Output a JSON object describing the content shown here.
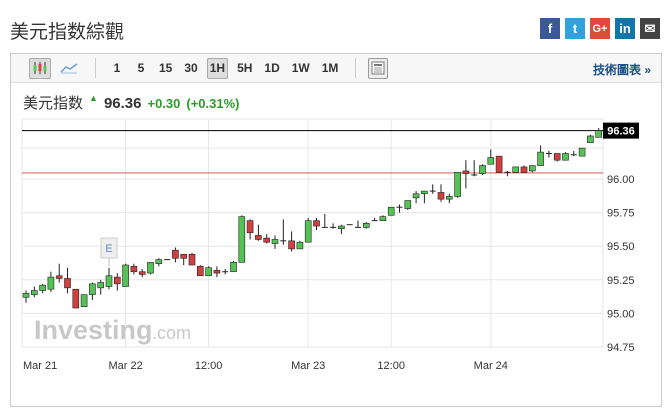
{
  "header": {
    "title": "美元指数綜觀"
  },
  "social": [
    {
      "name": "facebook",
      "glyph": "f",
      "color": "#3b5998"
    },
    {
      "name": "twitter",
      "glyph": "t",
      "color": "#2fa3e0"
    },
    {
      "name": "google-plus",
      "glyph": "G+",
      "color": "#dd4b39"
    },
    {
      "name": "linkedin",
      "glyph": "in",
      "color": "#0e76a8"
    },
    {
      "name": "email",
      "glyph": "✉",
      "color": "#444"
    }
  ],
  "toolbar": {
    "intervals": [
      "1",
      "5",
      "15",
      "30",
      "1H",
      "5H",
      "1D",
      "1W",
      "1M"
    ],
    "active": "1H",
    "tech_link": "技術圖表 »"
  },
  "quote": {
    "name": "美元指数",
    "price": "96.36",
    "change": "+0.30",
    "change_pct": "(+0.31%)"
  },
  "chart_data": {
    "type": "candlestick",
    "ylim": [
      94.75,
      96.45
    ],
    "yticks": [
      "96.00",
      "95.75",
      "95.50",
      "95.25",
      "95.00",
      "94.75"
    ],
    "last_price_label": "96.36",
    "last_price": 96.36,
    "reference_line": 96.045,
    "xlabels": [
      {
        "text": "Mar 21",
        "index": 1.7
      },
      {
        "text": "Mar 22",
        "index": 12
      },
      {
        "text": "12:00",
        "index": 22
      },
      {
        "text": "Mar 23",
        "index": 34
      },
      {
        "text": "12:00",
        "index": 44
      },
      {
        "text": "Mar 24",
        "index": 56
      }
    ],
    "event_marker": {
      "label": "E",
      "index": 10
    },
    "watermark": "Investing.com",
    "colors": {
      "up": "#55c255",
      "down": "#d04040"
    },
    "ohlc": [
      [
        95.12,
        95.17,
        95.08,
        95.15
      ],
      [
        95.14,
        95.2,
        95.12,
        95.17
      ],
      [
        95.17,
        95.22,
        95.15,
        95.21
      ],
      [
        95.18,
        95.31,
        95.16,
        95.27
      ],
      [
        95.28,
        95.37,
        95.23,
        95.26
      ],
      [
        95.26,
        95.34,
        95.15,
        95.19
      ],
      [
        95.18,
        95.18,
        95.04,
        95.04
      ],
      [
        95.05,
        95.14,
        95.05,
        95.14
      ],
      [
        95.14,
        95.23,
        95.1,
        95.22
      ],
      [
        95.19,
        95.25,
        95.14,
        95.23
      ],
      [
        95.2,
        95.34,
        95.18,
        95.28
      ],
      [
        95.27,
        95.3,
        95.17,
        95.22
      ],
      [
        95.2,
        95.37,
        95.2,
        95.36
      ],
      [
        95.35,
        95.37,
        95.29,
        95.31
      ],
      [
        95.31,
        95.33,
        95.27,
        95.29
      ],
      [
        95.3,
        95.38,
        95.29,
        95.38
      ],
      [
        95.37,
        95.41,
        95.35,
        95.4
      ],
      [
        95.4,
        95.4,
        95.4,
        95.4
      ],
      [
        95.47,
        95.49,
        95.38,
        95.41
      ],
      [
        95.44,
        95.44,
        95.36,
        95.41
      ],
      [
        95.44,
        95.45,
        95.36,
        95.36
      ],
      [
        95.35,
        95.36,
        95.28,
        95.28
      ],
      [
        95.28,
        95.35,
        95.28,
        95.34
      ],
      [
        95.32,
        95.35,
        95.27,
        95.3
      ],
      [
        95.31,
        95.33,
        95.29,
        95.31
      ],
      [
        95.31,
        95.39,
        95.31,
        95.38
      ],
      [
        95.38,
        95.73,
        95.38,
        95.72
      ],
      [
        95.69,
        95.7,
        95.55,
        95.6
      ],
      [
        95.58,
        95.66,
        95.54,
        95.55
      ],
      [
        95.56,
        95.59,
        95.52,
        95.53
      ],
      [
        95.52,
        95.58,
        95.48,
        95.55
      ],
      [
        95.54,
        95.7,
        95.51,
        95.54
      ],
      [
        95.54,
        95.61,
        95.46,
        95.48
      ],
      [
        95.48,
        95.54,
        95.48,
        95.53
      ],
      [
        95.53,
        95.71,
        95.53,
        95.69
      ],
      [
        95.69,
        95.71,
        95.62,
        95.65
      ],
      [
        95.64,
        95.74,
        95.64,
        95.64
      ],
      [
        95.64,
        95.67,
        95.63,
        95.64
      ],
      [
        95.63,
        95.66,
        95.59,
        95.65
      ],
      [
        95.66,
        95.66,
        95.66,
        95.66
      ],
      [
        95.64,
        95.69,
        95.64,
        95.64
      ],
      [
        95.64,
        95.68,
        95.63,
        95.67
      ],
      [
        95.69,
        95.71,
        95.69,
        95.69
      ],
      [
        95.69,
        95.73,
        95.69,
        95.72
      ],
      [
        95.73,
        95.79,
        95.73,
        95.79
      ],
      [
        95.79,
        95.81,
        95.75,
        95.79
      ],
      [
        95.78,
        95.84,
        95.77,
        95.84
      ],
      [
        95.86,
        95.91,
        95.82,
        95.89
      ],
      [
        95.89,
        95.91,
        95.82,
        95.91
      ],
      [
        95.91,
        95.96,
        95.89,
        95.91
      ],
      [
        95.9,
        95.96,
        95.83,
        95.85
      ],
      [
        95.85,
        95.89,
        95.82,
        95.87
      ],
      [
        95.87,
        96.05,
        95.86,
        96.05
      ],
      [
        96.06,
        96.14,
        95.93,
        96.04
      ],
      [
        96.03,
        96.14,
        96.02,
        96.03
      ],
      [
        96.04,
        96.11,
        96.03,
        96.1
      ],
      [
        96.11,
        96.22,
        96.11,
        96.16
      ],
      [
        96.17,
        96.17,
        96.05,
        96.05
      ],
      [
        96.05,
        96.06,
        96.02,
        96.05
      ],
      [
        96.05,
        96.09,
        96.05,
        96.09
      ],
      [
        96.09,
        96.1,
        96.05,
        96.05
      ],
      [
        96.06,
        96.1,
        96.05,
        96.1
      ],
      [
        96.1,
        96.25,
        96.1,
        96.2
      ],
      [
        96.19,
        96.21,
        96.16,
        96.19
      ],
      [
        96.19,
        96.19,
        96.13,
        96.14
      ],
      [
        96.14,
        96.2,
        96.14,
        96.19
      ],
      [
        96.18,
        96.21,
        96.17,
        96.18
      ],
      [
        96.17,
        96.23,
        96.17,
        96.23
      ],
      [
        96.27,
        96.33,
        96.27,
        96.32
      ],
      [
        96.31,
        96.38,
        96.31,
        96.36
      ]
    ]
  }
}
